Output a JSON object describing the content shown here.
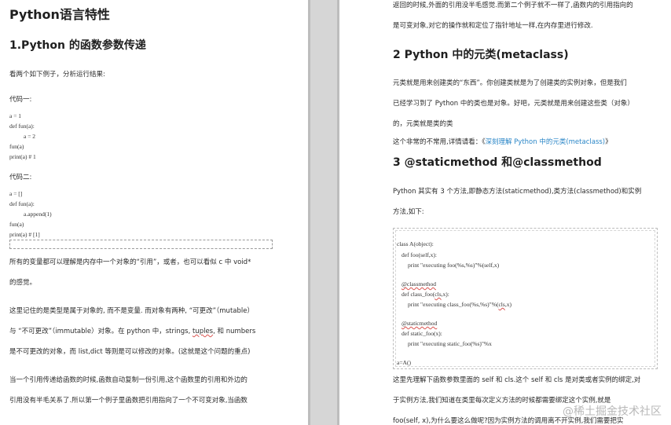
{
  "left": {
    "title": "Python语言特性",
    "section1_heading": "1.Python 的函数参数传递",
    "intro": "看两个如下例子，分析运行结果:",
    "code1_label": "代码一:",
    "code1_lines": [
      "a = 1",
      "def fun(a):",
      "a = 2",
      "fun(a)",
      "print(a)    # 1"
    ],
    "code2_label": "代码二:",
    "code2_lines": [
      "a = []",
      "def fun(a):",
      "a.append(1)",
      "fun(a)",
      "print(a)    # [1]"
    ],
    "paragraphs": [
      "所有的变量都可以理解是内存中一个对象的“引用”，或者，也可以看似 c 中 void*",
      "的感觉。",
      "这里记住的是类型是属于对象的, 而不是变量. 而对象有两种, “可更改”（mutable）",
      "与 “不可更改”（immutable）对象。在 python 中，strings, tuples, 和 numbers",
      "是不可更改的对象，而 list,dict 等则是可以修改的对象。(这就是这个问题的重点)",
      "当一个引用传递给函数的时候,函数自动复制一份引用,这个函数里的引用和外边的",
      "引用没有半毛关系了.所以第一个例子里函数把引用指向了一个不可变对象,当函数"
    ]
  },
  "right": {
    "top_lines": [
      "返回的时候,外面的引用没半毛感觉.而第二个例子就不一样了,函数内的引用指向的",
      "是可变对象,对它的操作就和定位了指针地址一样,在内存里进行修改."
    ],
    "section2_heading": "2 Python 中的元类(metaclass)",
    "section2_lines": [
      "元类就是用来创建类的“东西”。你创建类就是为了创建类的实例对象，但是我们",
      "已经学习到了 Python 中的类也是对象。好吧，元类就是用来创建这些类（对象）",
      "的，元类就是类的类"
    ],
    "section2_more_prefix": "这个非常的不常用,详情请看：《",
    "section2_more_link": "深刻理解 Python 中的元类(metaclass)",
    "section2_more_suffix": "》",
    "section3_heading": "3 @staticmethod 和@classmethod",
    "section3_lines": [
      "Python 其实有 3 个方法,即静态方法(staticmethod),类方法(classmethod)和实例",
      "方法,如下:"
    ],
    "code_lines": [
      "class A(object):",
      "def foo(self,x):",
      "print \"executing foo(%s,%s)\"%(self,x)",
      "",
      "@classmethod",
      "def class_foo(cls,x):",
      "print \"executing class_foo(%s,%s)\"%(cls,x)",
      "",
      "@staticmethod",
      "def static_foo(x):",
      "print \"executing static_foo(%s)\"%x",
      "",
      "a=A()"
    ],
    "bottom_lines": [
      "这里先理解下函数参数里面的 self 和 cls.这个 self 和 cls 是对类或者实例的绑定,对",
      "于实例方法,我们知道在类里每次定义方法的时候都需要绑定这个实例,就是",
      "foo(self, x),为什么要这么做呢?因为实例方法的调用离不开实例,我们需要把实"
    ],
    "watermark": "@稀土掘金技术社区"
  }
}
